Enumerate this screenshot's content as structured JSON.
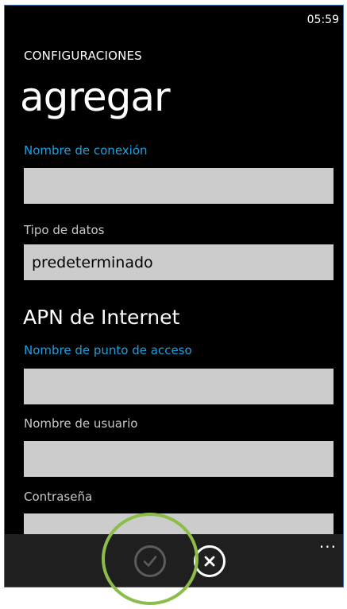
{
  "status_bar": {
    "time": "05:59"
  },
  "header": {
    "app_title": "CONFIGURACIONES",
    "page_title": "agregar"
  },
  "form": {
    "connection_name": {
      "label": "Nombre de conexión",
      "value": ""
    },
    "data_type": {
      "label": "Tipo de datos",
      "value": "predeterminado"
    },
    "section_heading": "APN de Internet",
    "access_point_name": {
      "label": "Nombre de punto de acceso",
      "value": ""
    },
    "username": {
      "label": "Nombre de usuario",
      "value": ""
    },
    "password": {
      "label": "Contraseña",
      "value": ""
    }
  },
  "app_bar": {
    "save_icon": "check-icon",
    "cancel_icon": "close-icon",
    "more": "..."
  },
  "colors": {
    "accent": "#1ba1e2",
    "background": "#000000",
    "textbox": "#cccccc",
    "app_bar": "#1f1f1f",
    "highlight": "#8cbd4a"
  }
}
